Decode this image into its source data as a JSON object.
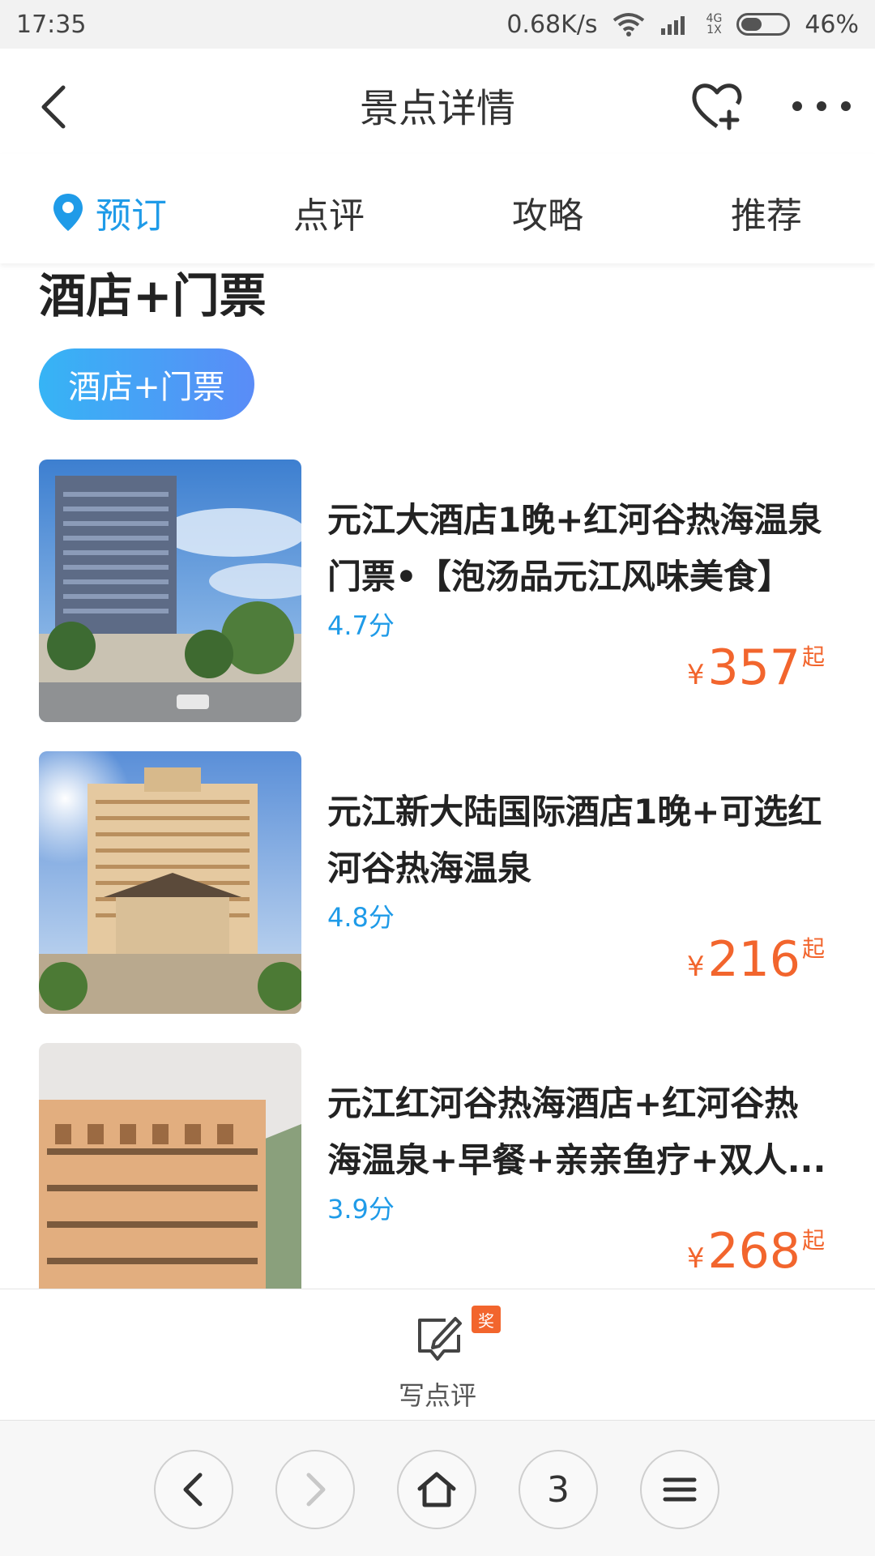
{
  "status_bar": {
    "time": "17:35",
    "speed": "0.68K/s",
    "network_top": "4G",
    "network_bottom": "1X",
    "battery_percent": "46%",
    "battery_level": 0.46
  },
  "header": {
    "title": "景点详情"
  },
  "tabs": [
    {
      "label": "预订",
      "active": true
    },
    {
      "label": "点评",
      "active": false
    },
    {
      "label": "攻略",
      "active": false
    },
    {
      "label": "推荐",
      "active": false
    }
  ],
  "section": {
    "title": "酒店+门票",
    "filter_chip": "酒店+门票"
  },
  "products": [
    {
      "name": "元江大酒店1晚+红河谷热海温泉门票•【泡汤品元江风味美食】",
      "score": "4.7分",
      "currency": "¥",
      "price": "357",
      "suffix": "起"
    },
    {
      "name": "元江新大陆国际酒店1晚+可选红河谷热海温泉",
      "score": "4.8分",
      "currency": "¥",
      "price": "216",
      "suffix": "起"
    },
    {
      "name": "元江红河谷热海酒店+红河谷热海温泉+早餐+亲亲鱼疗+双人...",
      "score": "3.9分",
      "currency": "¥",
      "price": "268",
      "suffix": "起"
    }
  ],
  "write_review": {
    "label": "写点评",
    "badge": "奖"
  },
  "browser_nav": {
    "tab_count": "3"
  },
  "colors": {
    "accent_blue": "#1f9be8",
    "price_orange": "#f2652d"
  }
}
